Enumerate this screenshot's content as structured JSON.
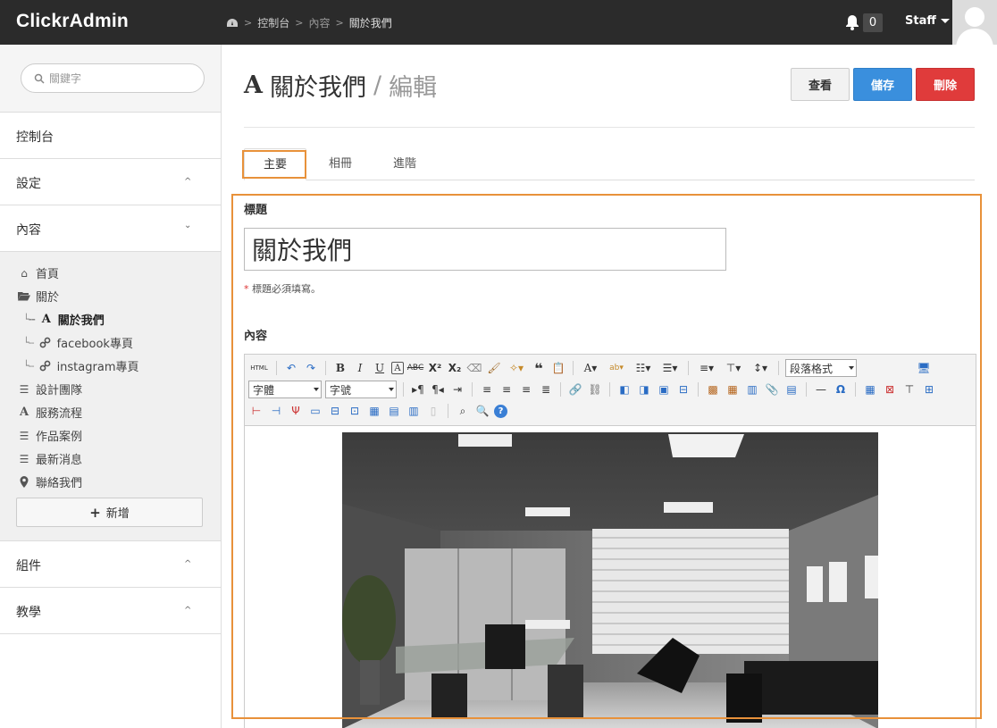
{
  "topbar": {
    "brand": "ClickrAdmin",
    "breadcrumb": [
      "控制台",
      "內容",
      "關於我們"
    ],
    "notification_count": "0",
    "user": "Staff"
  },
  "sidebar": {
    "search_placeholder": "關鍵字",
    "sections": {
      "dashboard": "控制台",
      "settings": "設定",
      "content": "內容",
      "components": "組件",
      "tutorial": "教學"
    },
    "tree": [
      {
        "label": "首頁",
        "icon": "home-icon"
      },
      {
        "label": "關於",
        "icon": "folder-open-icon"
      },
      {
        "label": "關於我們",
        "icon": "font-icon"
      },
      {
        "label": "facebook專頁",
        "icon": "link-icon"
      },
      {
        "label": "instagram專頁",
        "icon": "link-icon"
      },
      {
        "label": "設計團隊",
        "icon": "list-icon"
      },
      {
        "label": "服務流程",
        "icon": "font-icon"
      },
      {
        "label": "作品案例",
        "icon": "list-icon"
      },
      {
        "label": "最新消息",
        "icon": "list-icon"
      },
      {
        "label": "聯絡我們",
        "icon": "map-marker-icon"
      }
    ],
    "add_label": "新增"
  },
  "page": {
    "title": "關於我們",
    "subtitle": "編輯",
    "buttons": {
      "view": "查看",
      "save": "儲存",
      "delete": "刪除"
    },
    "tabs": [
      "主要",
      "相冊",
      "進階"
    ]
  },
  "form": {
    "title_label": "標題",
    "title_value": "關於我們",
    "title_hint_mark": "*",
    "title_hint": "標題必須填寫。",
    "content_label": "內容",
    "editor": {
      "html_label": "HTML",
      "format_select": "段落格式",
      "font_select": "字體",
      "size_select": "字號"
    }
  },
  "colors": {
    "topbar": "#2b2b2b",
    "save": "#3a8fdd",
    "delete": "#e03b3b",
    "highlight": "#e8913a"
  }
}
